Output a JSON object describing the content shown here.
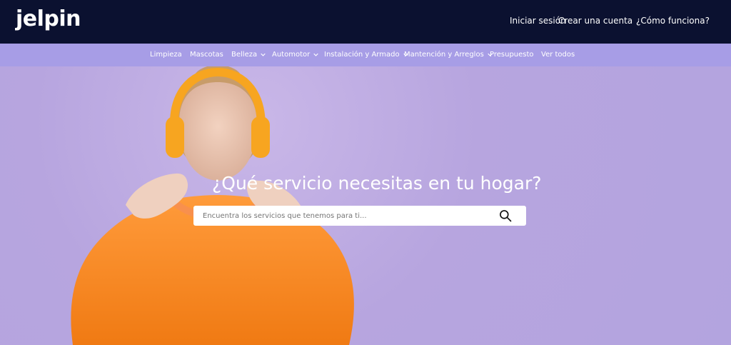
{
  "brand": {
    "name": "jelpin"
  },
  "header": {
    "login": "Iniciar sesión",
    "signup": "Crear una cuenta",
    "how": "¿Cómo funciona?"
  },
  "nav": {
    "items": [
      {
        "label": "Limpieza",
        "dropdown": false
      },
      {
        "label": "Mascotas",
        "dropdown": false
      },
      {
        "label": "Belleza",
        "dropdown": true
      },
      {
        "label": "Automotor",
        "dropdown": true
      },
      {
        "label": "Instalación y Armado",
        "dropdown": true
      },
      {
        "label": "Mantención y Arreglos",
        "dropdown": true
      },
      {
        "label": "Presupuesto",
        "dropdown": false
      },
      {
        "label": "Ver todos",
        "dropdown": false
      }
    ]
  },
  "hero": {
    "headline": "¿Qué servicio necesitas en tu hogar?",
    "search_placeholder": "Encuentra los servicios que tenemos para ti...",
    "search_icon": "search-icon"
  },
  "colors": {
    "topbar": "#0b1130",
    "navbar": "#a79de6",
    "hero": "#b7a5df",
    "sweater": "#ff8a2a",
    "headphones": "#f7a520"
  }
}
